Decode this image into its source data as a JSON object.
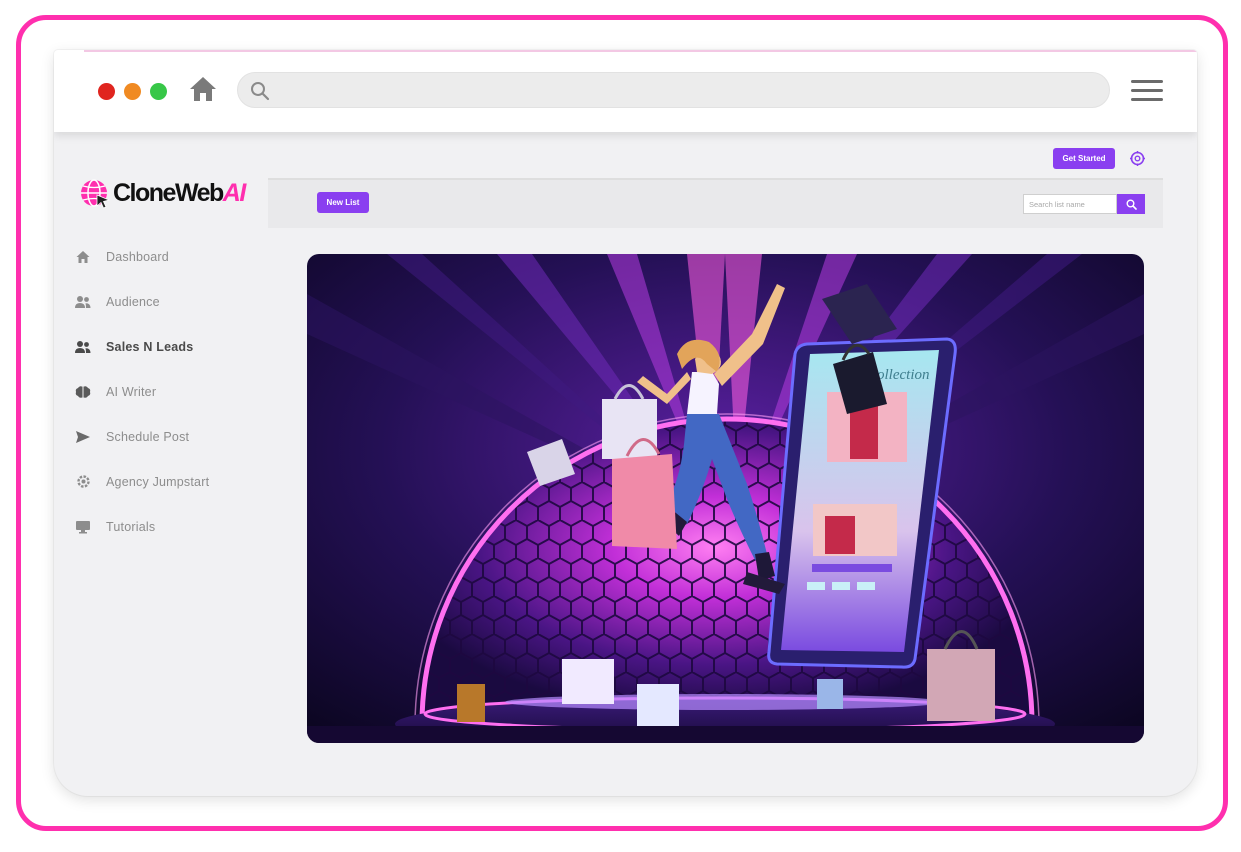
{
  "logo": {
    "text_main": "CloneWeb",
    "text_accent": "AI"
  },
  "sidebar": {
    "items": [
      {
        "label": "Dashboard",
        "icon": "home-icon",
        "active": false
      },
      {
        "label": "Audience",
        "icon": "users-icon",
        "active": false
      },
      {
        "label": "Sales N Leads",
        "icon": "users-icon",
        "active": true
      },
      {
        "label": "AI Writer",
        "icon": "brain-icon",
        "active": false
      },
      {
        "label": "Schedule Post",
        "icon": "send-icon",
        "active": false
      },
      {
        "label": "Agency Jumpstart",
        "icon": "gear-icon",
        "active": false
      },
      {
        "label": "Tutorials",
        "icon": "monitor-icon",
        "active": false
      }
    ]
  },
  "header": {
    "get_started_label": "Get Started"
  },
  "toolbar": {
    "new_list_label": "New List",
    "search_placeholder": "Search list name"
  },
  "hero": {
    "phone_text": "Collection"
  },
  "colors": {
    "accent": "#8a3ff0",
    "frame": "#ff2fae",
    "neon": "#ff4fd8"
  }
}
